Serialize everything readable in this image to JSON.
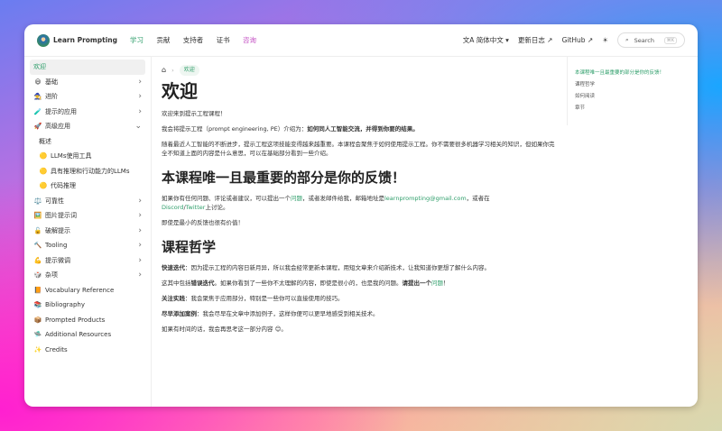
{
  "header": {
    "brand": "Learn Prompting",
    "nav": [
      "学习",
      "贡献",
      "支持者",
      "证书",
      "咨询"
    ],
    "language": "简体中文",
    "changelog": "更新日志",
    "github": "GitHub",
    "search_placeholder": "Search",
    "search_shortcut": "⌘K"
  },
  "sidebar": {
    "items": [
      {
        "label": "欢迎",
        "icon": "",
        "chevron": ""
      },
      {
        "label": "基础",
        "icon": "😃",
        "chevron": "›"
      },
      {
        "label": "进阶",
        "icon": "🧙",
        "chevron": "›"
      },
      {
        "label": "提示的应用",
        "icon": "🧪",
        "chevron": "›"
      },
      {
        "label": "高级应用",
        "icon": "🚀",
        "chevron": "⌄"
      },
      {
        "label": "概述",
        "icon": "",
        "chevron": "",
        "sub": true
      },
      {
        "label": "LLMs使用工具",
        "icon": "🟡",
        "chevron": "",
        "sub": true
      },
      {
        "label": "具有推理和行动能力的LLMs",
        "icon": "🟡",
        "chevron": "",
        "sub": true
      },
      {
        "label": "代码推理",
        "icon": "🟡",
        "chevron": "",
        "sub": true
      },
      {
        "label": "可靠性",
        "icon": "⚖️",
        "chevron": "›"
      },
      {
        "label": "图片提示词",
        "icon": "🖼️",
        "chevron": "›"
      },
      {
        "label": "破解提示",
        "icon": "🔓",
        "chevron": "›"
      },
      {
        "label": "Tooling",
        "icon": "🔨",
        "chevron": "›"
      },
      {
        "label": "提示微调",
        "icon": "💪",
        "chevron": "›"
      },
      {
        "label": "杂项",
        "icon": "🎲",
        "chevron": "›"
      },
      {
        "label": "Vocabulary Reference",
        "icon": "📙",
        "chevron": ""
      },
      {
        "label": "Bibliography",
        "icon": "📚",
        "chevron": ""
      },
      {
        "label": "Prompted Products",
        "icon": "📦",
        "chevron": ""
      },
      {
        "label": "Additional Resources",
        "icon": "🛸",
        "chevron": ""
      },
      {
        "label": "Credits",
        "icon": "✨",
        "chevron": ""
      }
    ]
  },
  "main": {
    "breadcrumb": "欢迎",
    "title": "欢迎",
    "p1": "欢迎来到提示工程课程！",
    "p2a": "我会将提示工程（prompt engineering, PE）介绍为：",
    "p2b": "如何同人工智能交流，并得到你要的结果。",
    "p3": "随着最近人工智能的不断进步，提示工程这项技能变得越来越重要。本课程会聚焦于如何使用提示工程。你不需要很多机器学习相关的知识，但如果你完全不知道上面的内容是什么意思，可以在基础部分看到一些介绍。",
    "h2": "本课程唯一且最重要的部分是你的反馈！",
    "p4a": "如果你有任何问题、评论或者建议，可以提出一个",
    "p4link": "问题",
    "p4b": "，或者发邮件给我，邮箱地址是",
    "email": "learnprompting@gmail.com",
    "p4c": "，或者在",
    "discord": "Discord",
    "slash": "/",
    "twitter": "Twitter",
    "p4d": "上讨论。",
    "p5": "即使是最小的反馈也很有价值！",
    "h3": "课程哲学",
    "p6b": "快速迭代",
    "p6": "：因为提示工程的内容日新月异，所以我会经常更新本课程，用短文章来介绍新技术，让我知道你更想了解什么内容。",
    "p7a": "这其中包括",
    "p7b": "错误迭代",
    "p7c": "。如果你看到了一些你不太理解的内容，即使是很小的，也是我的问题。",
    "p7d": "请提出一个",
    "p7link": "问题",
    "p7e": "！",
    "p8b": "关注实践",
    "p8": "：我会聚焦于应用部分，特别是一些你可以直接使用的技巧。",
    "p9b": "尽早添加案例",
    "p9": "：我会尽早在文章中添加例子，这样你便可以更早地感受到相关技术。",
    "p10": "如果有时间的话，我会再思考这一部分内容 😊。"
  },
  "toc": [
    "本课程唯一且最重要的部分是你的反馈！",
    "课程哲学",
    "如何阅读",
    "章节"
  ],
  "colors": {
    "accent": "#2e9e6a",
    "consult": "#c34fc3"
  }
}
